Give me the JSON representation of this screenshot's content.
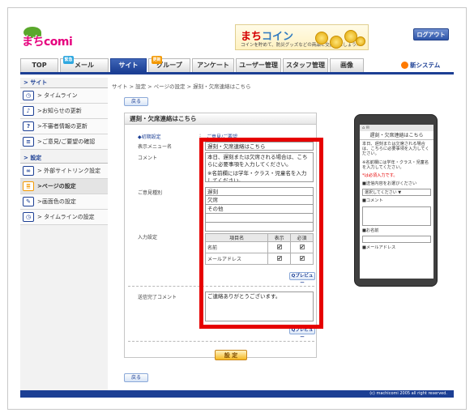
{
  "header": {
    "logo_text": "まちcomi",
    "banner_title_red": "まち",
    "banner_title_blue": "コイン",
    "banner_sub": "コインを貯めて、防災グッズなどの商品と交換しましょう!",
    "logout_label": "ログアウト"
  },
  "nav": {
    "tabs": [
      {
        "label": "TOP"
      },
      {
        "label": "メール",
        "badge": "緊急"
      },
      {
        "label": "サイト"
      },
      {
        "label": "グループ",
        "badge": "更新"
      },
      {
        "label": "アンケート"
      },
      {
        "label": "ユーザー管理"
      },
      {
        "label": "スタッフ管理"
      },
      {
        "label": "画像"
      }
    ],
    "new_system": "新システム"
  },
  "sidebar": {
    "site_heading": "サイト",
    "site_items": [
      {
        "label": "> タイムライン",
        "icon": "clock-icon"
      },
      {
        "label": ">お知らせの更新",
        "icon": "bell-icon"
      },
      {
        "label": ">不審者情報の更新",
        "icon": "question-icon"
      },
      {
        "label": ">ご意見/ご要望の確認",
        "icon": "list-icon"
      }
    ],
    "settings_heading": "設定",
    "settings_items": [
      {
        "label": "> 外部サイトリンク設定",
        "icon": "link-icon"
      },
      {
        "label": ">ページの設定",
        "icon": "page-icon"
      },
      {
        "label": ">画面色の設定",
        "icon": "brush-icon"
      },
      {
        "label": "> タイムラインの設定",
        "icon": "clock-icon"
      }
    ]
  },
  "main": {
    "breadcrumb": "サイト > 設定 > ページの設定 > 遅刻・欠席連絡はこちら",
    "back_label": "戻る",
    "card_title": "遅刻・欠席連絡はこちら",
    "initial_settings_label": "◆初期設定",
    "initial_settings_value": "ご意見/ご要望",
    "menu_name_label": "表示メニュー名",
    "menu_name_value": "遅刻・欠席連絡はこちら",
    "comment_label": "コメント",
    "comment_value_1": "本日、遅刻または欠席される場合は、こちらに必要事項を入力してください。",
    "comment_value_2": "※名前欄には学年・クラス・児童名を入力してください。",
    "opinion_type_label": "ご意見種別",
    "opinion_types": [
      "遅刻",
      "欠席",
      "その他",
      "",
      ""
    ],
    "input_settings_label": "入力設定",
    "input_table": {
      "headers": [
        "項目名",
        "表示",
        "必須"
      ],
      "rows": [
        {
          "name": "名前",
          "show": "✔",
          "required": "✔"
        },
        {
          "name": "メールアドレス",
          "show": "✔",
          "required": "✔"
        }
      ]
    },
    "preview_label": "Qプレビュー",
    "done_comment_label": "送信完了コメント",
    "done_comment_value": "ご連絡ありがとうございます。",
    "submit_label": "設 定"
  },
  "phone": {
    "title": "遅刻・欠席連絡はこちら",
    "text_1": "本日、遅刻または欠席される場合は、こちらに必要事項を入力してください。",
    "text_2": "※名前欄には学年・クラス・児童名を入力してください。",
    "required_note": "*は必須入力です。",
    "send_label": "■送信内容をお選びください",
    "select_value": "選択してください ▼",
    "comment_label": "■コメント",
    "name_label": "■お名前",
    "mail_label": "■メールアドレス"
  },
  "footer": {
    "copyright": "(c) machicomi 2005 all right reserved."
  },
  "colors": {
    "brand_blue": "#1c3f94",
    "highlight_red": "#e60000",
    "accent_orange": "#f39800"
  }
}
